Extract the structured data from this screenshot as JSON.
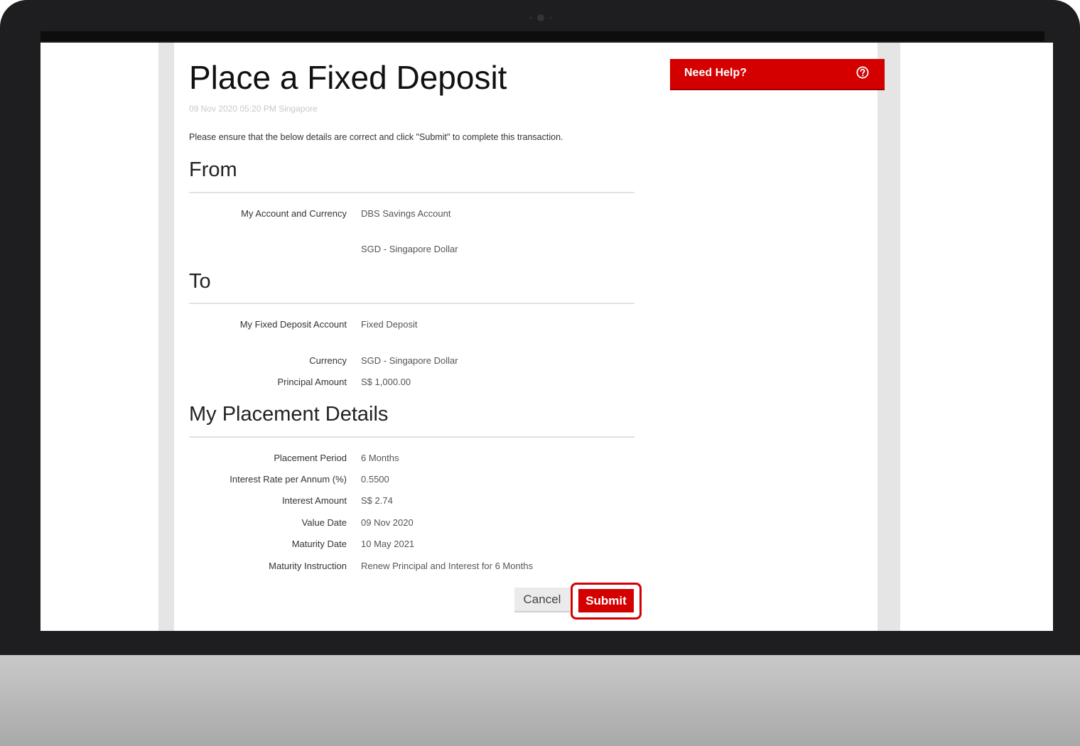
{
  "page": {
    "title": "Place a Fixed Deposit",
    "timestamp": "09 Nov 2020 05:20 PM Singapore",
    "instruction": "Please ensure that the below details are correct and click \"Submit\" to complete this transaction."
  },
  "help": {
    "label": "Need Help?",
    "icon": "question-circle-icon"
  },
  "from": {
    "heading": "From",
    "rows": [
      {
        "label": "My Account and Currency",
        "value": "DBS Savings Account"
      },
      {
        "label": "",
        "value": "SGD - Singapore Dollar"
      }
    ]
  },
  "to": {
    "heading": "To",
    "rows": [
      {
        "label": "My Fixed Deposit Account",
        "value": "Fixed Deposit"
      },
      {
        "label": "Currency",
        "value": "SGD - Singapore Dollar"
      },
      {
        "label": "Principal Amount",
        "value": "S$ 1,000.00"
      }
    ]
  },
  "placement": {
    "heading": "My Placement Details",
    "rows": [
      {
        "label": "Placement Period",
        "value": "6 Months"
      },
      {
        "label": "Interest Rate per Annum (%)",
        "value": "0.5500"
      },
      {
        "label": "Interest Amount",
        "value": "S$ 2.74"
      },
      {
        "label": "Value Date",
        "value": "09 Nov 2020"
      },
      {
        "label": "Maturity Date",
        "value": "10 May 2021"
      },
      {
        "label": "Maturity Instruction",
        "value": "Renew Principal and Interest for 6 Months"
      }
    ]
  },
  "actions": {
    "cancel_label": "Cancel",
    "submit_label": "Submit"
  },
  "colors": {
    "accent": "#d40000",
    "highlight_outline": "#d40000"
  }
}
